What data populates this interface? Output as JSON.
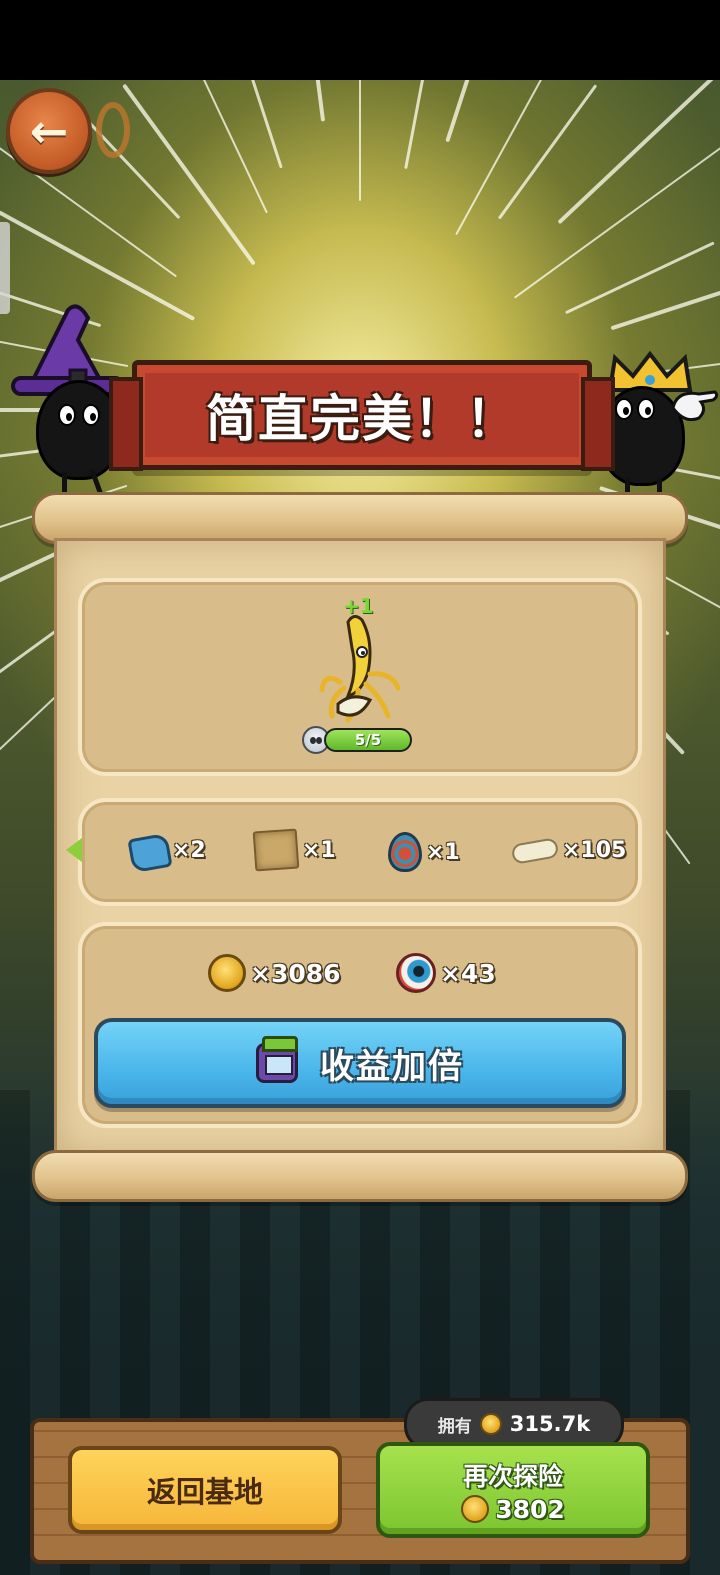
{
  "banner": {
    "title": "简直完美！！"
  },
  "pet": {
    "plus_badge": "+1",
    "level_text": "5/5",
    "level_fraction": 1.0
  },
  "rewards": [
    {
      "icon": "blue-gem-icon",
      "qty": "×2"
    },
    {
      "icon": "map-scroll-icon",
      "qty": "×1"
    },
    {
      "icon": "spiral-egg-icon",
      "qty": "×1"
    },
    {
      "icon": "bone-icon",
      "qty": "×105"
    }
  ],
  "earnings": [
    {
      "icon": "gold-coin-icon",
      "qty": "×3086"
    },
    {
      "icon": "eyeball-icon",
      "qty": "×43"
    }
  ],
  "double_button": {
    "label": "收益加倍",
    "icon": "tv-icon"
  },
  "owned": {
    "label": "拥有",
    "value": "315.7k",
    "icon": "gold-coin-icon"
  },
  "home_button": {
    "label": "返回基地"
  },
  "retry_button": {
    "label": "再次探险",
    "cost": "3802",
    "icon": "gold-coin-icon"
  },
  "back_button": {
    "icon": "back-arrow-icon"
  },
  "colors": {
    "banner": "#b23a2a",
    "double_button": "#4ab6ea",
    "home_button": "#f5b63a",
    "retry_button": "#7cc530",
    "level_fill": "#7ccf3a"
  }
}
